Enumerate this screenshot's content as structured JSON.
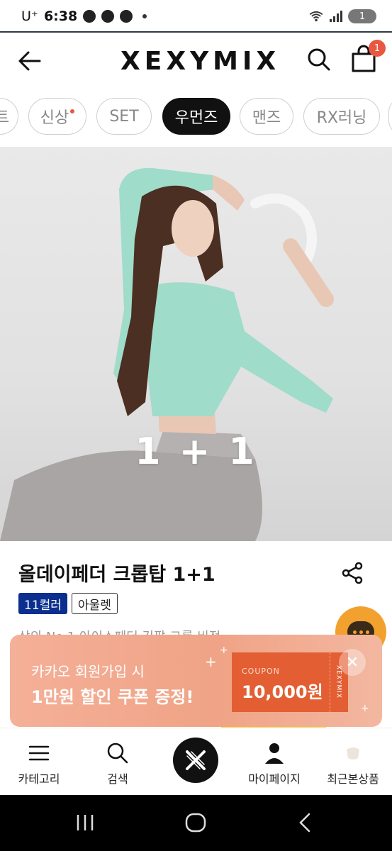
{
  "status_bar": {
    "carrier": "U⁺",
    "time": "6:38",
    "battery": "1"
  },
  "header": {
    "logo": "XEXYMIX",
    "cart_count": "1"
  },
  "categories": [
    "트",
    "신상",
    "SET",
    "우먼즈",
    "맨즈",
    "RX러닝"
  ],
  "hero": {
    "overlay_text": "1 + 1"
  },
  "product": {
    "title": "올데이페더 크롭탑 1+1",
    "color_tag": "11컬러",
    "outlet_tag": "아울렛",
    "description": "상의 No.1 아이스페더 긴팔 크롭 비전"
  },
  "banner": {
    "line1": "카카오 회원가입 시",
    "line2": "1만원 할인 쿠폰 증정!",
    "coupon_label": "COUPON",
    "coupon_value": "10,000원",
    "coupon_brand": "XEXYMIX",
    "close": "✕"
  },
  "bottom_nav": {
    "category": "카테고리",
    "search": "검색",
    "mypage": "마이페이지",
    "recent": "최근본상품"
  },
  "colors": {
    "accent": "#e8573f",
    "tag_blue": "#0b2f8f",
    "coupon_orange": "#e35f33",
    "chat_yellow": "#f2a12e"
  }
}
